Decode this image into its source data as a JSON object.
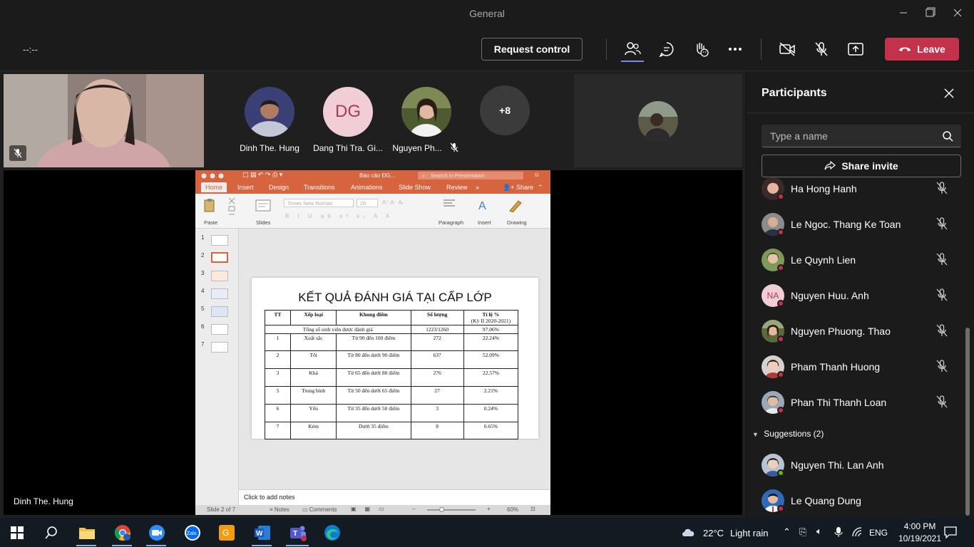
{
  "window": {
    "title": "General"
  },
  "call": {
    "timer": "--:--",
    "request_control": "Request control",
    "leave": "Leave"
  },
  "stage": {
    "tiles": [
      {
        "name": "Dinh The. Hung"
      },
      {
        "name": "Dang Thi Tra. Gi...",
        "initials": "DG",
        "color": "#f1cdd6"
      },
      {
        "name": "Nguyen Ph..."
      },
      {
        "name": "+8"
      }
    ],
    "presenter_name": "Dinh The. Hung"
  },
  "ppt": {
    "doc_title": "Báo cáo ĐG...",
    "search_placeholder": "Search in Presentation",
    "tabs": [
      "Home",
      "Insert",
      "Design",
      "Transitions",
      "Animations",
      "Slide Show",
      "Review",
      "»"
    ],
    "share": "Share",
    "font_name": "Times New Roman",
    "font_size": "20",
    "tool_labels": {
      "paste": "Paste",
      "slides": "Slides",
      "paragraph": "Paragraph",
      "insert": "Insert",
      "drawing": "Drawing"
    },
    "thumb_numbers": [
      "1",
      "2",
      "3",
      "4",
      "5",
      "6",
      "7"
    ],
    "slide_title": "KẾT QUẢ ĐÁNH GIÁ TẠI CẤP LỚP",
    "table": {
      "headers": [
        "TT",
        "Xếp loại",
        "Khung điểm",
        "Số lượng",
        "Tỉ lệ %"
      ],
      "header_sub": "(Kỳ II 2020-2021)",
      "total_label": "Tổng số sinh viên được đánh giá",
      "total_count": "1223/1260",
      "total_pct": "97.06%",
      "rows": [
        [
          "1",
          "Xuất sắc",
          "Từ 90 đến 100 điểm",
          "272",
          "22.24%"
        ],
        [
          "2",
          "Tốt",
          "Từ 80 đến dưới 90 điểm",
          "637",
          "52.09%"
        ],
        [
          "3",
          "Khá",
          "Từ 65 đến dưới 80 điểm",
          "276",
          "22.57%"
        ],
        [
          "5",
          "Trung bình",
          "Từ 50 đến dưới 65 điểm",
          "27",
          "2.21%"
        ],
        [
          "6",
          "Yếu",
          "Từ 35 đến dưới 50 điểm",
          "3",
          "0.24%"
        ],
        [
          "7",
          "Kém",
          "Dưới 35 điểm",
          "8",
          "0.65%"
        ]
      ]
    },
    "notes_placeholder": "Click to add notes",
    "status": {
      "slide": "Slide 2 of 7",
      "notes": "Notes",
      "comments": "Comments",
      "zoom": "60%"
    }
  },
  "panel": {
    "title": "Participants",
    "search_placeholder": "Type a name",
    "share_invite": "Share invite",
    "participants": [
      {
        "name": "Ha Hong Hanh",
        "avatar_color": "#8a4a3a"
      },
      {
        "name": "Le Ngoc. Thang Ke Toan",
        "avatar_color": "#7f7f7f"
      },
      {
        "name": "Le Quynh Lien",
        "avatar_color": "#6f8a4f"
      },
      {
        "name": "Nguyen Huu. Anh",
        "initials": "NA",
        "avatar_color": "#f1cdd6"
      },
      {
        "name": "Nguyen Phuong. Thao",
        "avatar_color": "#5a6a3a"
      },
      {
        "name": "Pham Thanh Huong",
        "avatar_color": "#c9b9b0"
      },
      {
        "name": "Phan Thi Thanh Loan",
        "avatar_color": "#7a8a9a"
      }
    ],
    "suggestions_label": "Suggestions (2)",
    "suggestions": [
      {
        "name": "Nguyen Thi. Lan Anh",
        "avatar_color": "#6a7a9a",
        "status": "#6bb700"
      },
      {
        "name": "Le Quang Dung",
        "avatar_color": "#3f6fb0",
        "status": "#c4314b"
      }
    ]
  },
  "taskbar": {
    "weather": "22°C",
    "weather_desc": "Light rain",
    "lang": "ENG",
    "time": "4:00 PM",
    "date": "10/19/2021"
  }
}
